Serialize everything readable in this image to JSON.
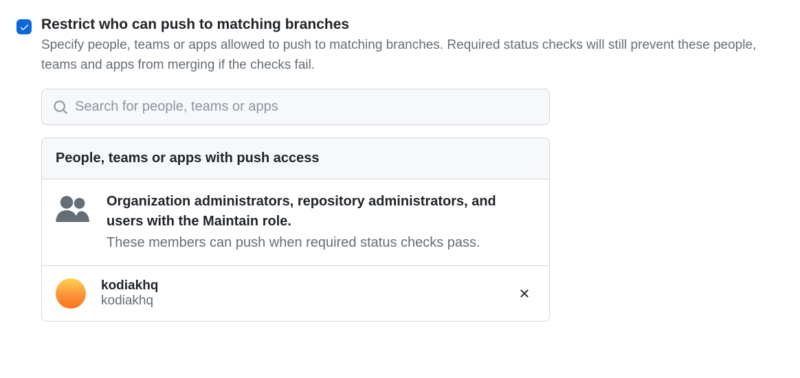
{
  "setting": {
    "checked": true,
    "title": "Restrict who can push to matching branches",
    "description": "Specify people, teams or apps allowed to push to matching branches. Required status checks will still prevent these people, teams and apps from merging if the checks fail."
  },
  "search": {
    "placeholder": "Search for people, teams or apps"
  },
  "panel": {
    "header": "People, teams or apps with push access",
    "admin_item": {
      "title": "Organization administrators, repository administrators, and users with the Maintain role.",
      "subtitle": "These members can push when required status checks pass."
    },
    "entries": [
      {
        "name": "kodiakhq",
        "slug": "kodiakhq"
      }
    ]
  }
}
